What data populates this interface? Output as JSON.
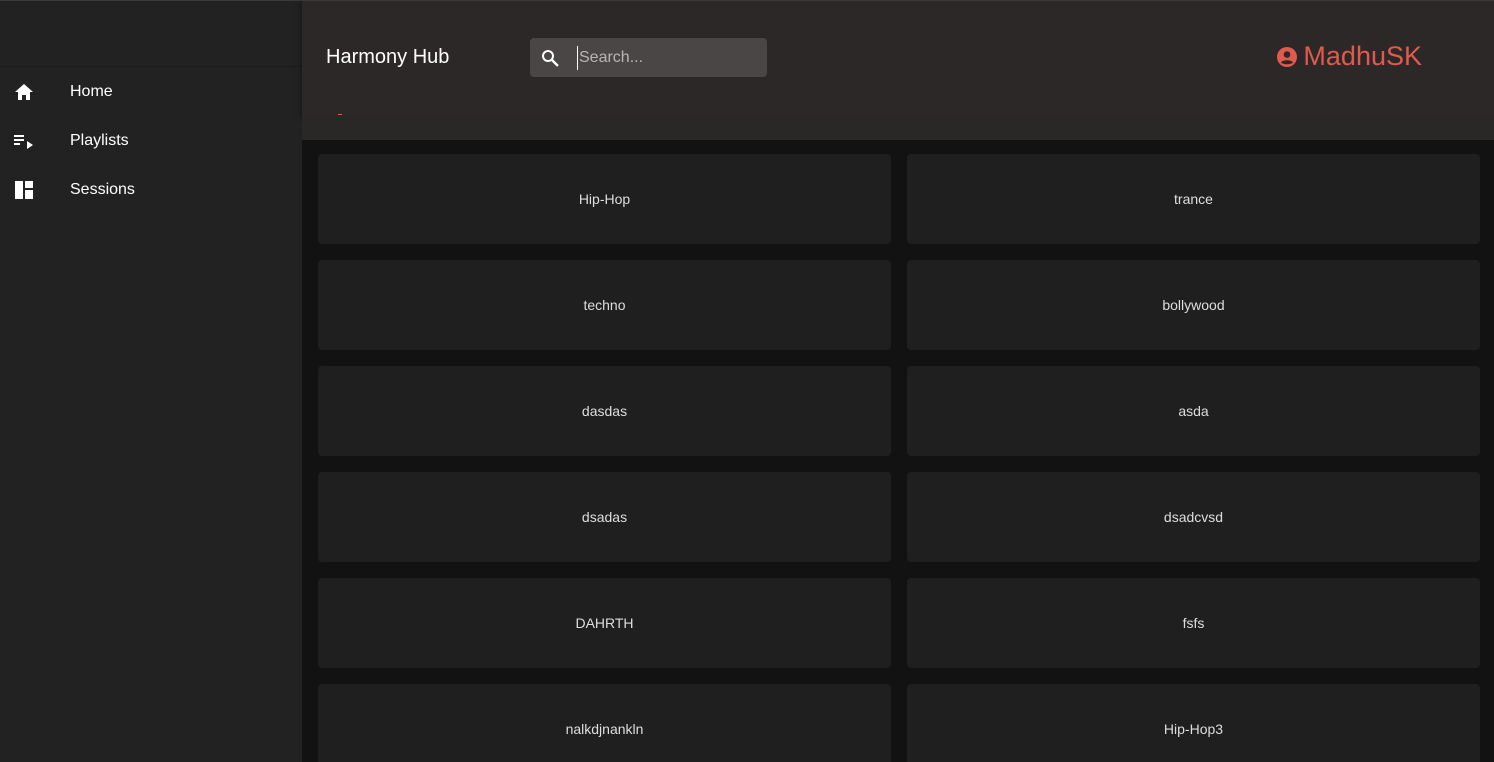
{
  "sidebar": {
    "items": [
      {
        "label": "Home",
        "icon": "home-icon"
      },
      {
        "label": "Playlists",
        "icon": "playlist-icon"
      },
      {
        "label": "Sessions",
        "icon": "dashboard-icon"
      }
    ]
  },
  "header": {
    "title": "Harmony Hub",
    "search_placeholder": "Search...",
    "search_value": "",
    "user_name": "MadhuSK",
    "user_icon": "account-circle-icon"
  },
  "colors": {
    "accent": "#e05a4e",
    "sidebar_bg": "#222222",
    "header_bg": "#2c2828",
    "main_bg": "#121212",
    "card_bg": "#1f1f1f"
  },
  "playlists": [
    "Hip-Hop",
    "trance",
    "techno",
    "bollywood",
    "dasdas",
    "asda",
    "dsadas",
    "dsadcvsd",
    "DAHRTH",
    "fsfs",
    "nalkdjnankln",
    "Hip-Hop3"
  ]
}
